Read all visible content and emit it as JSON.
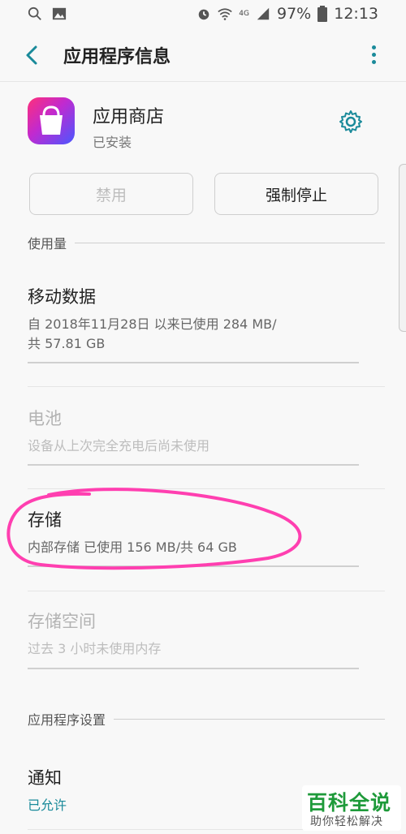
{
  "status_bar": {
    "battery": "97%",
    "time": "12:13",
    "network_label": "4G"
  },
  "app_bar": {
    "title": "应用程序信息"
  },
  "app": {
    "name": "应用商店",
    "status": "已安装"
  },
  "buttons": {
    "disable": "禁用",
    "force_stop": "强制停止"
  },
  "sections": {
    "usage": "使用量",
    "app_settings": "应用程序设置"
  },
  "items": {
    "mobile_data": {
      "title": "移动数据",
      "subtitle_line1": "自 2018年11月28日 以来已使用 284 MB/",
      "subtitle_line2": "共 57.81 GB"
    },
    "battery": {
      "title": "电池",
      "subtitle": "设备从上次完全充电后尚未使用"
    },
    "storage": {
      "title": "存储",
      "subtitle": "内部存储 已使用 156 MB/共 64 GB"
    },
    "memory": {
      "title": "存储空间",
      "subtitle": "过去 3 小时未使用内存"
    },
    "notifications": {
      "title": "通知",
      "subtitle": "已允许"
    }
  },
  "watermark": {
    "main": "百科全说",
    "sub": "助你轻松解决"
  },
  "colors": {
    "accent": "#1a8a9a",
    "annotation": "#ff3fb0",
    "watermark": "#1e9a3a"
  }
}
